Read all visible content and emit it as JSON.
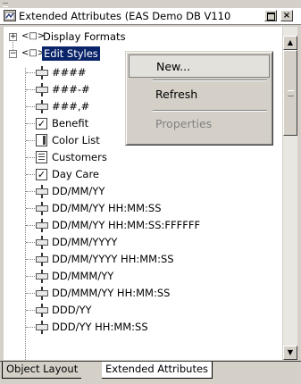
{
  "window": {
    "title": "Extended Attributes (EAS Demo DB V110",
    "restore_label": "",
    "close_label": "×"
  },
  "tree": {
    "display_formats": {
      "label": "Display Formats",
      "expander": "+",
      "brackets": "<□>"
    },
    "edit_styles": {
      "label": "Edit Styles",
      "expander": "−",
      "brackets": "<□>"
    },
    "items": [
      {
        "label": "####",
        "icon": "edit-mask-icon"
      },
      {
        "label": "###-#",
        "icon": "edit-mask-icon"
      },
      {
        "label": "###,#",
        "icon": "edit-mask-icon"
      },
      {
        "label": "Benefit",
        "icon": "checkbox-icon"
      },
      {
        "label": "Color List",
        "icon": "dropdown-list-icon"
      },
      {
        "label": "Customers",
        "icon": "listbox-icon"
      },
      {
        "label": "Day Care",
        "icon": "checkbox-icon"
      },
      {
        "label": "DD/MM/YY",
        "icon": "edit-mask-icon"
      },
      {
        "label": "DD/MM/YY HH:MM:SS",
        "icon": "edit-mask-icon"
      },
      {
        "label": "DD/MM/YY HH:MM:SS:FFFFFF",
        "icon": "edit-mask-icon"
      },
      {
        "label": "DD/MM/YYYY",
        "icon": "edit-mask-icon"
      },
      {
        "label": "DD/MM/YYYY HH:MM:SS",
        "icon": "edit-mask-icon"
      },
      {
        "label": "DD/MMM/YY",
        "icon": "edit-mask-icon"
      },
      {
        "label": "DD/MMM/YY HH:MM:SS",
        "icon": "edit-mask-icon"
      },
      {
        "label": "DDD/YY",
        "icon": "edit-mask-icon"
      },
      {
        "label": "DDD/YY HH:MM:SS",
        "icon": "edit-mask-icon"
      }
    ]
  },
  "context_menu": {
    "new": "New...",
    "refresh": "Refresh",
    "properties": "Properties"
  },
  "tabs": [
    {
      "label": "Object Layout",
      "active": false
    },
    {
      "label": "Extended Attributes",
      "active": true
    }
  ],
  "colors": {
    "selection": "#0a246a",
    "chrome": "#d4d0c8",
    "disabled_text": "#808080"
  }
}
